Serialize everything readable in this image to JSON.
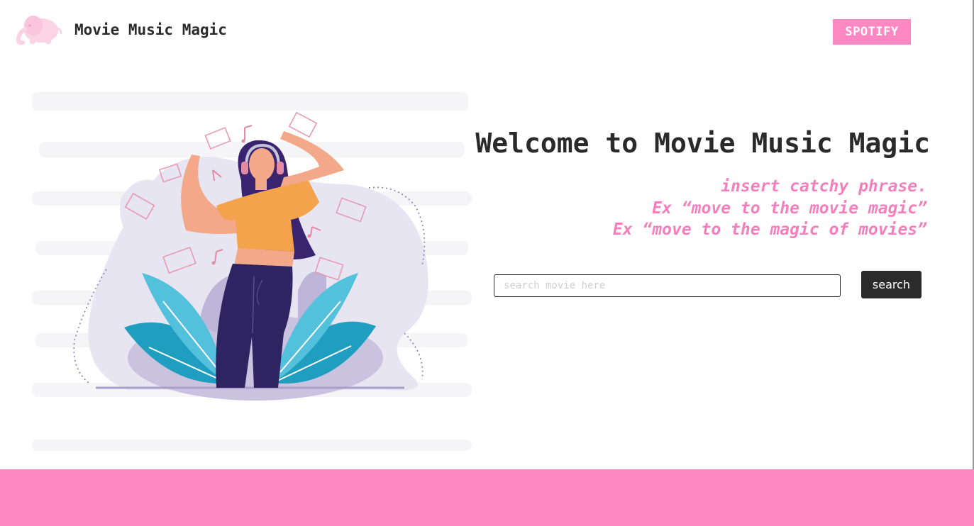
{
  "header": {
    "brand": "Movie Music Magic",
    "spotify_label": "SPOTIFY"
  },
  "hero": {
    "title": "Welcome to Movie Music Magic",
    "tagline_lines": [
      "insert catchy phrase.",
      "Ex “move to the movie magic”",
      "Ex “move to the magic of movies”"
    ]
  },
  "search": {
    "placeholder": "search movie here",
    "value": "",
    "button_label": "search"
  },
  "colors": {
    "accent_pink": "#ff88c2",
    "tagline_pink": "#f47fbd",
    "dark": "#2b2b2b"
  },
  "icons": [
    "elephant-logo-icon",
    "dancing-woman-illustration"
  ]
}
